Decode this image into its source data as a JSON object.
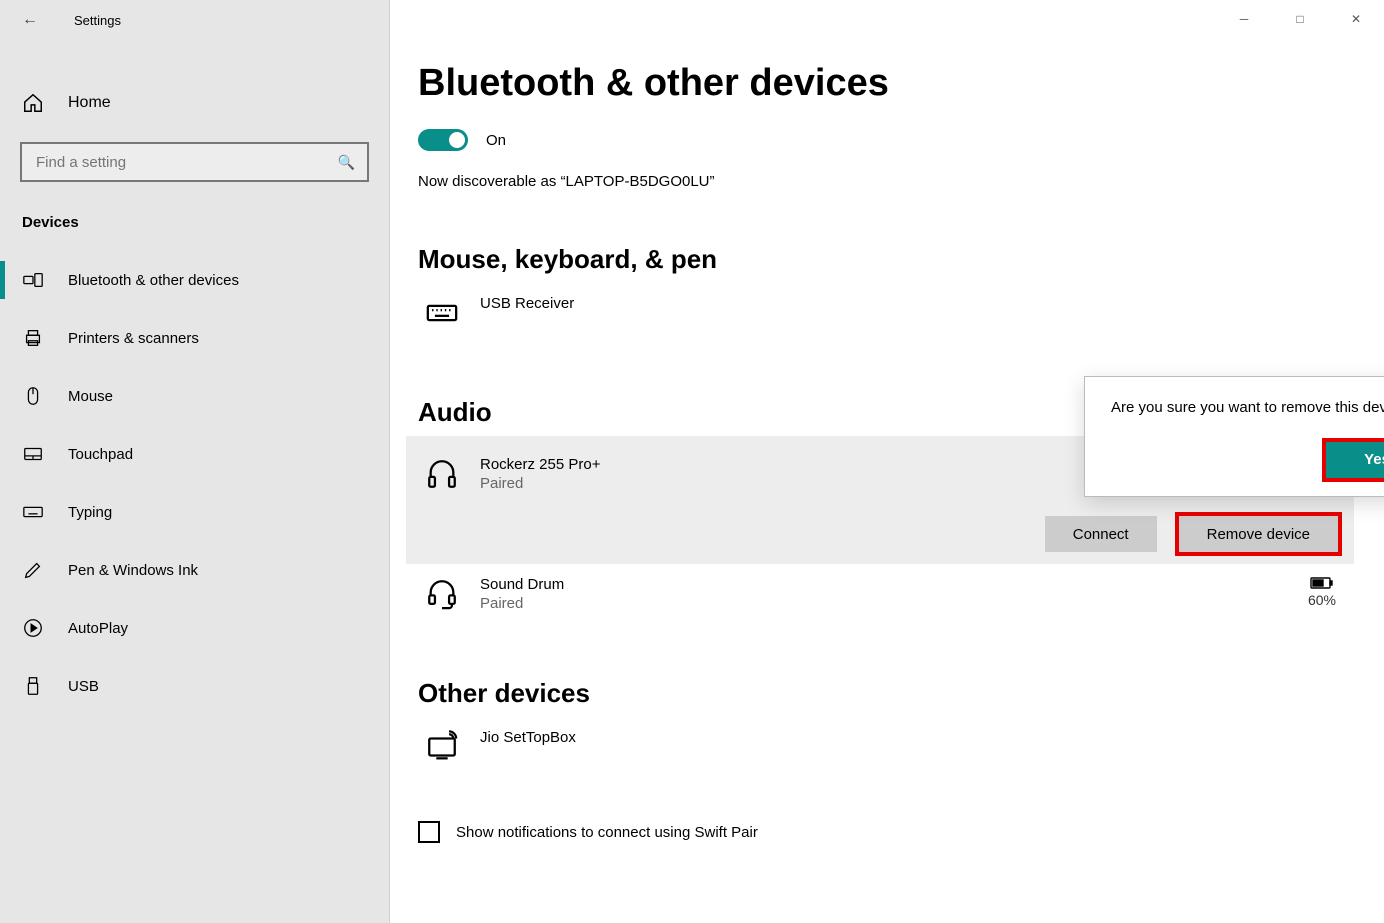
{
  "window": {
    "title": "Settings"
  },
  "sidebar": {
    "home": "Home",
    "search_placeholder": "Find a setting",
    "category": "Devices",
    "items": [
      {
        "label": "Bluetooth & other devices"
      },
      {
        "label": "Printers & scanners"
      },
      {
        "label": "Mouse"
      },
      {
        "label": "Touchpad"
      },
      {
        "label": "Typing"
      },
      {
        "label": "Pen & Windows Ink"
      },
      {
        "label": "AutoPlay"
      },
      {
        "label": "USB"
      }
    ]
  },
  "page": {
    "title": "Bluetooth & other devices",
    "toggle_state": "On",
    "discoverable": "Now discoverable as “LAPTOP-B5DGO0LU”",
    "sections": {
      "mouse": {
        "title": "Mouse, keyboard, & pen",
        "device": "USB Receiver"
      },
      "audio": {
        "title": "Audio",
        "devices": [
          {
            "name": "Rockerz 255 Pro+",
            "status": "Paired"
          },
          {
            "name": "Sound Drum",
            "status": "Paired",
            "battery": "60%"
          }
        ],
        "connect_label": "Connect",
        "remove_label": "Remove device"
      },
      "other": {
        "title": "Other devices",
        "device": "Jio SetTopBox"
      }
    },
    "swift_pair": "Show notifications to connect using Swift Pair"
  },
  "popup": {
    "message": "Are you sure you want to remove this device?",
    "yes": "Yes"
  }
}
